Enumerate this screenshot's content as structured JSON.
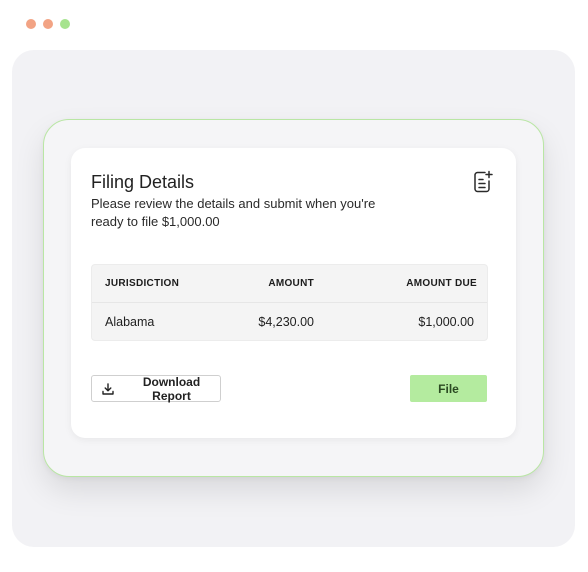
{
  "window": {
    "dot_colors": [
      "#f2a384",
      "#f2a384",
      "#a6e38e"
    ]
  },
  "colors": {
    "accent_green": "#b4eb9f",
    "device_border": "#b9e6a4"
  },
  "card": {
    "title": "Filing Details",
    "subtitle": "Please review the details and submit when you're ready to file $1,000.00",
    "icon": "document-add-icon"
  },
  "table": {
    "headers": [
      "JURISDICTION",
      "AMOUNT",
      "AMOUNT DUE"
    ],
    "rows": [
      [
        "Alabama",
        "$4,230.00",
        "$1,000.00"
      ]
    ]
  },
  "actions": {
    "download_label": "Download Report",
    "download_icon": "download-icon",
    "file_label": "File"
  }
}
